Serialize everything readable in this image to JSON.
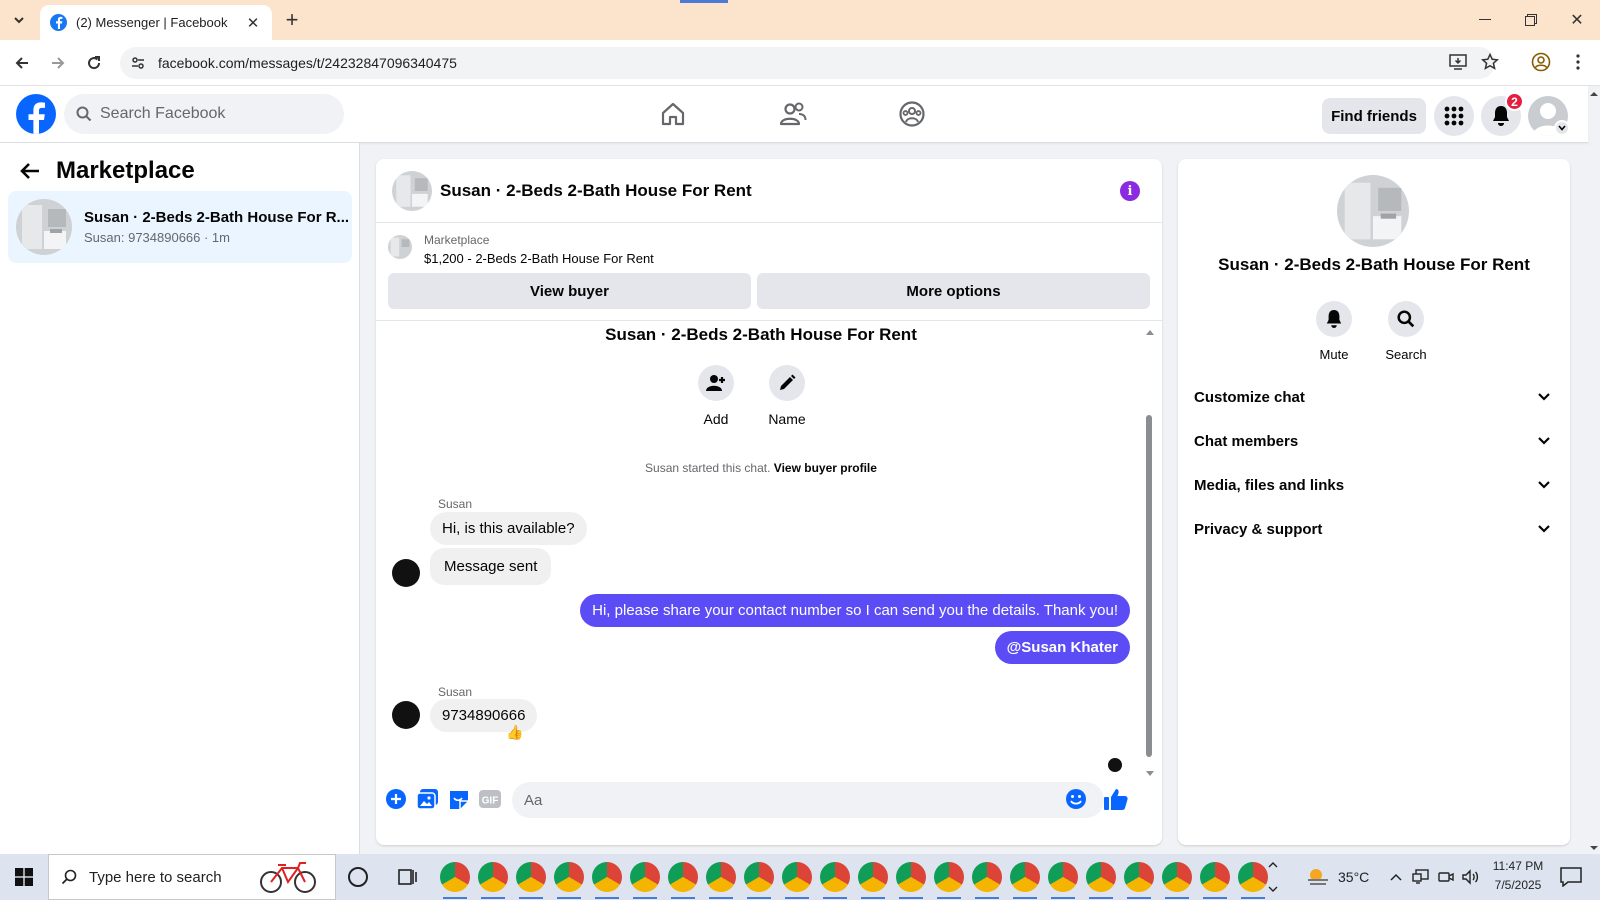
{
  "browser": {
    "tab_title": "(2) Messenger | Facebook",
    "url": "facebook.com/messages/t/24232847096340475"
  },
  "header": {
    "search_placeholder": "Search Facebook",
    "find_friends": "Find friends",
    "notification_count": "2",
    "accent_color": "#0866ff"
  },
  "sidebar": {
    "title": "Marketplace",
    "conversations": [
      {
        "title": "Susan · 2-Beds 2-Bath House For R...",
        "subtitle": "Susan: 9734890666 · 1m"
      }
    ]
  },
  "chat": {
    "title": "Susan · 2-Beds 2-Bath House For Rent",
    "marketplace": {
      "label": "Marketplace",
      "listing": "$1,200 - 2-Beds 2-Bath House For Rent",
      "view_buyer": "View buyer",
      "more_options": "More options"
    },
    "thread_title": "Susan · 2-Beds 2-Bath House For Rent",
    "actions": {
      "add": "Add",
      "name": "Name"
    },
    "system_text": "Susan started this chat.",
    "system_link": "View buyer profile",
    "messages": [
      {
        "sender": "Susan",
        "text": "Hi, is this available?"
      },
      {
        "text": "Message sent"
      },
      {
        "text": "Hi, please share your contact number so I can send you the details. Thank you!"
      },
      {
        "text": "@Susan Khater"
      },
      {
        "sender": "Susan",
        "text": "9734890666",
        "reaction": "👍"
      }
    ],
    "composer_placeholder": "Aa",
    "outgoing_color": "#5b4cf5"
  },
  "details": {
    "title": "Susan · 2-Beds 2-Bath House For Rent",
    "mute": "Mute",
    "search": "Search",
    "sections": [
      "Customize chat",
      "Chat members",
      "Media, files and links",
      "Privacy & support"
    ]
  },
  "taskbar": {
    "search_placeholder": "Type here to search",
    "temperature": "35°C",
    "time": "11:47 PM",
    "date": "7/5/2025"
  }
}
